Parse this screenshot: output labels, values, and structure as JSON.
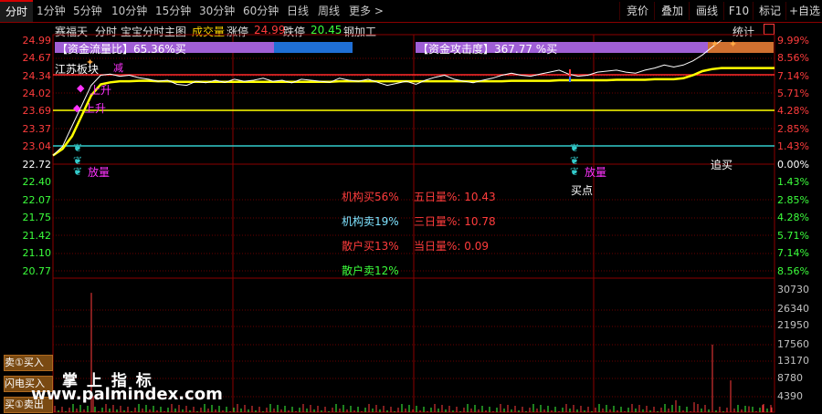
{
  "tabs": [
    {
      "label": "分时",
      "active": true
    },
    {
      "label": "1分钟"
    },
    {
      "label": "5分钟"
    },
    {
      "label": "10分钟"
    },
    {
      "label": "15分钟"
    },
    {
      "label": "30分钟"
    },
    {
      "label": "60分钟"
    },
    {
      "label": "日线"
    },
    {
      "label": "周线"
    },
    {
      "label": "更多 >"
    }
  ],
  "right_buttons": [
    "竞价",
    "叠加",
    "画线",
    "F10",
    "标记",
    "+自选"
  ],
  "info": {
    "stock_name": "赛福天",
    "view": "分时",
    "indicator": "宝宝分时主图",
    "volume_label": "成交量",
    "limit_up_label": "涨停",
    "limit_up_value": "24.99",
    "limit_down_label": "跌停",
    "limit_down_value": "20.45",
    "sector": "钢加工",
    "stats_label": "统计"
  },
  "price_labels_left": [
    "24.99",
    "24.67",
    "24.34",
    "24.02",
    "23.69",
    "23.37",
    "23.04",
    "22.72",
    "22.40",
    "22.07",
    "21.75",
    "21.42",
    "21.10",
    "20.77"
  ],
  "pct_labels_right": [
    "9.99%",
    "8.56%",
    "7.14%",
    "5.71%",
    "4.28%",
    "2.85%",
    "1.43%",
    "0.00%",
    "1.43%",
    "2.85%",
    "4.28%",
    "5.71%",
    "7.14%",
    "8.56%"
  ],
  "volume_labels_right": [
    "30730",
    "26340",
    "21950",
    "17560",
    "13170",
    "8780",
    "4390"
  ],
  "colors": {
    "up": "#ff3c3c",
    "down": "#3cff3c",
    "flat": "#ffffff",
    "price_line": "#ffffff",
    "avg_line": "#ffff00",
    "cyan_line": "#33cccc",
    "magenta": "#ff33ff"
  },
  "panels": {
    "fund_flow": {
      "label": "【资金流量比】65.36%买",
      "buy_pct": 65.36
    },
    "fund_attack": {
      "label": "【资金攻击度】367.77 %买"
    }
  },
  "annotations": {
    "sector_tag": "江苏板块",
    "up_tag": "上升",
    "fang_liang": "放量",
    "buy_point": "买点",
    "chase_buy": "追买",
    "jian_tag": "减"
  },
  "stats": [
    {
      "label": "机构买56%",
      "color": "#ff3c3c"
    },
    {
      "label": "机构卖19%",
      "color": "#7fe3ff"
    },
    {
      "label": "散户买13%",
      "color": "#ff3c3c"
    },
    {
      "label": "散户卖12%",
      "color": "#3cff3c"
    }
  ],
  "volume_ratios": [
    {
      "label": "五日量%: 10.43"
    },
    {
      "label": "三日量%: 10.78"
    },
    {
      "label": "当日量%: 0.09"
    }
  ],
  "side_buttons": [
    "卖①买入",
    "闪电买入",
    "买①卖出"
  ],
  "watermark": {
    "line1": "掌 上 指 标",
    "line2": "www.palmindex.com"
  },
  "chart_data": {
    "type": "line",
    "prev_close": 22.72,
    "limit_up": 24.99,
    "limit_down": 20.45,
    "ylim": [
      20.45,
      24.99
    ],
    "volume_ylim": [
      0,
      30730
    ],
    "series": [
      {
        "values": [
          22.72,
          22.9,
          23.3,
          23.7,
          24.1,
          24.3,
          24.32,
          24.28,
          24.3,
          24.25,
          24.22,
          24.18,
          24.2,
          24.12,
          24.1,
          24.18,
          24.15,
          24.2,
          24.16,
          24.22,
          24.18,
          24.2,
          24.24,
          24.18,
          24.2,
          24.15,
          24.22,
          24.2,
          24.18,
          24.16,
          24.24,
          24.2,
          24.18,
          24.22,
          24.16,
          24.1,
          24.14,
          24.18,
          24.12,
          24.2,
          24.26,
          24.3,
          24.22,
          24.18,
          24.15,
          24.2,
          24.24,
          24.3,
          24.34,
          24.3,
          24.28,
          24.32,
          24.36,
          24.4,
          24.32,
          24.28,
          24.3,
          24.36,
          24.38,
          24.4,
          24.36,
          24.34,
          24.4,
          24.44,
          24.5,
          24.46,
          24.5,
          24.58,
          24.7,
          24.85,
          24.99
        ]
      },
      {
        "values": [
          22.72,
          22.85,
          23.1,
          23.5,
          23.9,
          24.12,
          24.16,
          24.18,
          24.18,
          24.19,
          24.19,
          24.18,
          24.18,
          24.17,
          24.17,
          24.17,
          24.17,
          24.17,
          24.17,
          24.17,
          24.17,
          24.17,
          24.17,
          24.17,
          24.17,
          24.17,
          24.17,
          24.17,
          24.17,
          24.17,
          24.18,
          24.18,
          24.18,
          24.18,
          24.18,
          24.18,
          24.18,
          24.18,
          24.18,
          24.18,
          24.18,
          24.18,
          24.18,
          24.18,
          24.18,
          24.18,
          24.18,
          24.18,
          24.19,
          24.19,
          24.19,
          24.19,
          24.19,
          24.2,
          24.2,
          24.2,
          24.2,
          24.2,
          24.2,
          24.21,
          24.21,
          24.21,
          24.21,
          24.22,
          24.22,
          24.22,
          24.24,
          24.3,
          24.38,
          24.42,
          24.44
        ]
      }
    ],
    "levels": [
      24.34,
      23.69,
      23.04
    ]
  }
}
